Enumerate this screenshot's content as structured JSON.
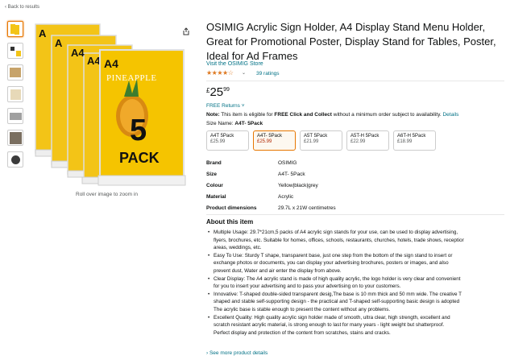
{
  "nav": {
    "back_label": "‹ Back to results"
  },
  "gallery": {
    "thumbnail_count": 7,
    "rollover_hint": "Roll over image to zoom in",
    "image_text": {
      "a4": "A4",
      "brand_word": "PINEAPPLE",
      "count": "5",
      "pack": "PACK"
    }
  },
  "product": {
    "title": "OSIMIG Acrylic Sign Holder, A4 Display Stand Menu Holder, Great for Promotional Poster, Display Stand for Tables, Poster, Ideal for Ad Frames",
    "store_link": "Visit the OSIMIG Store",
    "stars": "★★★★☆",
    "rating_value": 4.4,
    "ratings_label": "39 ratings",
    "price": {
      "currency": "£",
      "whole": "25",
      "fraction": "99"
    },
    "returns": "FREE Returns ˅",
    "note_prefix": "Note:",
    "note_text": " This item is eligible for ",
    "note_bold": "FREE Click and Collect",
    "note_rest": " without a minimum order subject to availability. ",
    "note_link": "Details",
    "size_label": "Size Name: ",
    "size_value": "A4T- 5Pack"
  },
  "variants": [
    {
      "name": "A4T 5Pack",
      "price": "£25.99",
      "selected": false
    },
    {
      "name": "A4T- 5Pack",
      "price": "£25.99",
      "selected": true
    },
    {
      "name": "A5T 5Pack",
      "price": "£21.99",
      "selected": false
    },
    {
      "name": "A5T-H 5Pack",
      "price": "£22.99",
      "selected": false
    },
    {
      "name": "A6T-H 5Pack",
      "price": "£18.99",
      "selected": false
    }
  ],
  "specs": [
    {
      "key": "Brand",
      "value": "OSIMIG"
    },
    {
      "key": "Size",
      "value": "A4T- 5Pack"
    },
    {
      "key": "Colour",
      "value": "Yellow|black|grey"
    },
    {
      "key": "Material",
      "value": "Acrylic"
    },
    {
      "key": "Product dimensions",
      "value": "29.7L x 21W centimetres"
    }
  ],
  "about": {
    "heading": "About this item",
    "bullets": [
      "Multiple Usage: 29.7*21cm,5 packs of A4 acrylic sign stands for your use, can be used to display advertising,\nflyers, brochures, etc. Suitable for homes, offices, schools, restaurants, churches, hotels, trade shows, receptior\nareas, weddings, etc.",
      "Easy To Use: Sturdy T shape, transparent base, just one step from the bottom of the sign stand to insert or\nexchange photos or documents, you can display your advertising brochures, posters or images, and also\nprevent dust, Water and air enter the display from above.",
      "Clear Display: The A4 acrylic stand is made of high quality acrylic, the logo holder is very clear and convenient\nfor you to insert your advertising and to pass your advertising on to your customers.",
      "Innovative: T-shaped double-sided transparent desig,The base is 10 mm thick and 50 mm wide. The creative T\nshaped and stable self-supporting design - the practical and T-shaped self-supporting basic design is adopted\nThe acrylic base is stable enough to present the content without any problems.",
      "Excellent Quality: High quality acrylic sign holder made of smooth, ultra clear, high strength, excellent and\nscratch resistant acrylic material, is strong enough to last for many years - light weight but shatterproof.\nPerfect display and protection of the content from scratches, stains and cracks."
    ],
    "see_more": "› See more product details"
  },
  "colors": {
    "link": "#007185",
    "star": "#de7921",
    "selected_border": "#e77600",
    "sign_yellow": "#f3c417"
  }
}
